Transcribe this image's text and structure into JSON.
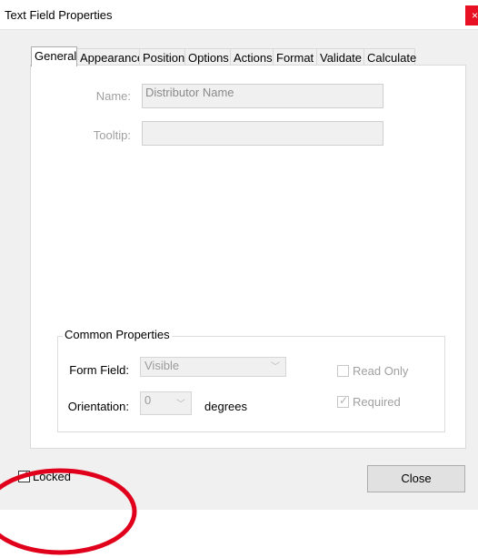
{
  "window": {
    "title": "Text Field Properties",
    "close_glyph": "×"
  },
  "tabs": [
    {
      "label": "General",
      "active": true
    },
    {
      "label": "Appearance"
    },
    {
      "label": "Position"
    },
    {
      "label": "Options"
    },
    {
      "label": "Actions"
    },
    {
      "label": "Format"
    },
    {
      "label": "Validate"
    },
    {
      "label": "Calculate"
    }
  ],
  "general": {
    "name_label": "Name:",
    "name_value": "Distributor Name",
    "tooltip_label": "Tooltip:",
    "tooltip_value": ""
  },
  "common_properties": {
    "legend": "Common Properties",
    "form_field_label": "Form Field:",
    "form_field_value": "Visible",
    "orientation_label": "Orientation:",
    "orientation_value": "0",
    "degrees_label": "degrees",
    "read_only_label": "Read Only",
    "read_only_checked": false,
    "required_label": "Required",
    "required_checked": true
  },
  "footer": {
    "locked_label": "Locked",
    "locked_checked": true,
    "close_label": "Close"
  },
  "colors": {
    "annotation_circle": "#e0001b",
    "close_button": "#e81123"
  },
  "icons": {
    "chevron": "chevron-down-icon",
    "check": "checkmark-icon"
  }
}
